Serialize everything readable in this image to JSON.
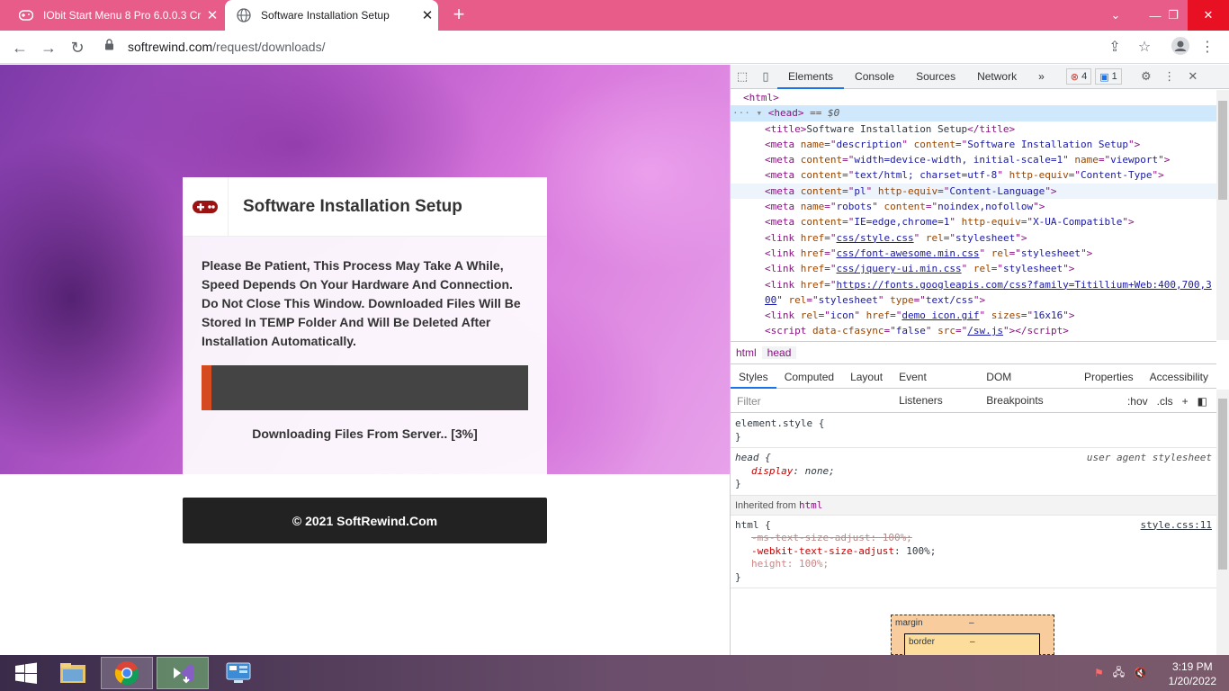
{
  "browser": {
    "tabs": [
      {
        "title": "IObit Start Menu 8 Pro 6.0.0.3 Cr",
        "active": false
      },
      {
        "title": "Software Installation Setup",
        "active": true
      }
    ],
    "new_tab_icon": "plus-icon",
    "url_host": "softrewind.com",
    "url_path": "/request/downloads/"
  },
  "page": {
    "card_title": "Software Installation Setup",
    "message": "Please Be Patient, This Process May Take A While, Speed Depends On Your Hardware And Connection. Do Not Close This Window. Downloaded Files Will Be Stored In TEMP Folder And Will Be Deleted After Installation Automatically.",
    "progress_percent": 3,
    "status": "Downloading Files From Server.. [3%]",
    "footer": "© 2021 SoftRewind.Com",
    "colors": {
      "progress_fill": "#d64a1f",
      "progress_track": "#444444",
      "footer_bg": "#222222"
    }
  },
  "devtools": {
    "tabs": [
      "Elements",
      "Console",
      "Sources",
      "Network"
    ],
    "more": "»",
    "errors": "4",
    "messages": "1",
    "code_lines": {
      "l0": "<html>",
      "l1_tag": "<head>",
      "l1_eq": " == $0",
      "l2": [
        "<title>",
        "Software Installation Setup",
        "</title>"
      ],
      "l3": {
        "name": "description",
        "content": "Software Installation Setup"
      },
      "l4": {
        "content": "width=device-width, initial-scale=1",
        "name": "viewport"
      },
      "l5": {
        "content": "text/html; charset=utf-8",
        "http_equiv": "Content-Type"
      },
      "l6": {
        "content": "pl",
        "http_equiv": "Content-Language"
      },
      "l7": {
        "name": "robots",
        "content": "noindex,nofollow"
      },
      "l8": {
        "content": "IE=edge,chrome=1",
        "http_equiv": "X-UA-Compatible"
      },
      "l9": "css/style.css",
      "l10": "css/font-awesome.min.css",
      "l11": "css/jquery-ui.min.css",
      "l12a": "https://fonts.googleapis.com/css?family=Titillium+Web:400,700,3",
      "l12b": "00",
      "l13": "demo icon.gif",
      "l13_sizes": "16x16",
      "l14": "/sw.js"
    },
    "breadcrumbs": [
      "html",
      "head"
    ],
    "subtabs": [
      "Styles",
      "Computed",
      "Layout",
      "Event Listeners",
      "DOM Breakpoints",
      "Properties",
      "Accessibility"
    ],
    "filter_placeholder": "Filter",
    "filter_hov": ":hov",
    "filter_cls": ".cls",
    "rules": {
      "element_style": "element.style {",
      "head_selector": "head {",
      "head_source": "user agent stylesheet",
      "head_prop": "display",
      "head_val": "none;",
      "inherited_label": "Inherited from",
      "inherited_tag": "html",
      "html_selector": "html {",
      "html_source": "style.css:11",
      "p1": "-ms-text-size-adjust: 100%;",
      "p2_name": "-webkit-text-size-adjust",
      "p2_val": "100%;",
      "p3": "height: 100%;",
      "close": "}"
    },
    "boxmodel": {
      "margin": "margin",
      "margin_val": "–",
      "border": "border",
      "border_val": "–"
    }
  },
  "taskbar": {
    "time": "3:19 PM",
    "date": "1/20/2022"
  }
}
